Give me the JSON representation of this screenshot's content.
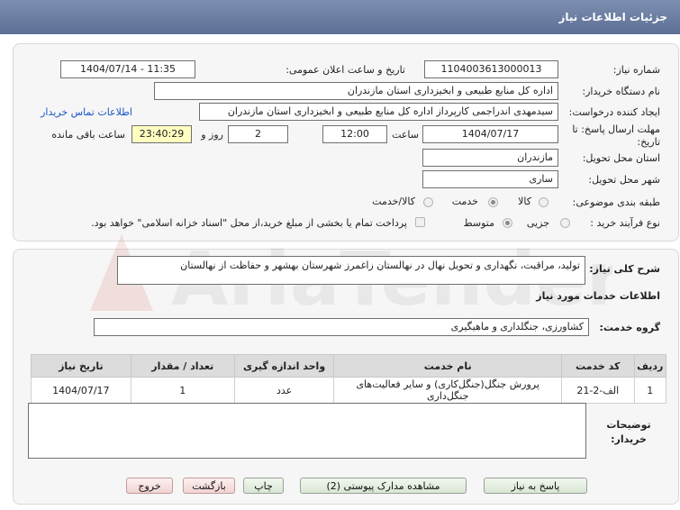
{
  "header": {
    "title": "جزئیات اطلاعات نیاز"
  },
  "form": {
    "need_number_label": "شماره نیاز:",
    "need_number": "1104003613000013",
    "announce_label": "تاریخ و ساعت اعلان عمومی:",
    "announce_value": "1404/07/14 - 11:35",
    "buyer_org_label": "نام دستگاه خریدار:",
    "buyer_org": "اداره کل منابع طبیعی و ابخیزداری استان مازندران",
    "requester_label": "ایجاد کننده درخواست:",
    "requester": "سیدمهدی اندراجمی کارپرداز اداره کل منابع طبیعی و ابخیزداری استان مازندران",
    "contact_link": "اطلاعات تماس خریدار",
    "deadline_label": "مهلت ارسال پاسخ: تا تاریخ:",
    "deadline_date": "1404/07/17",
    "time_label": "ساعت",
    "deadline_time": "12:00",
    "days_value": "2",
    "days_label": "روز و",
    "remaining_time": "23:40:29",
    "remaining_label": "ساعت باقی مانده",
    "province_label": "استان محل تحویل:",
    "province": "مازندران",
    "city_label": "شهر محل تحویل:",
    "city": "ساری",
    "category_label": "طبقه بندی موضوعی:",
    "category_options": [
      "کالا",
      "خدمت",
      "کالا/خدمت"
    ],
    "purchase_type_label": "نوع فرآیند خرید :",
    "purchase_options": [
      "جزیی",
      "متوسط"
    ],
    "treasury_note": "پرداخت تمام یا بخشی از مبلغ خرید،از محل \"اسناد خزانه اسلامی\" خواهد بود."
  },
  "description": {
    "label": "شرح کلی نیاز:",
    "text": "تولید، مراقبت، نگهداری و تحویل نهال در نهالستان زاغمرز شهرستان بهشهر و حفاظت از نهالستان"
  },
  "services": {
    "section_title": "اطلاعات خدمات مورد نیاز",
    "group_label": "گروه خدمت:",
    "group_value": "کشاورزی، جنگلداری و ماهیگیری",
    "columns": [
      "ردیف",
      "کد خدمت",
      "نام خدمت",
      "واحد اندازه گیری",
      "تعداد / مقدار",
      "تاریخ نیاز"
    ],
    "rows": [
      [
        "1",
        "الف-2-21",
        "پرورش جنگل(جنگل‌کاری) و سایر فعالیت‌های جنگل‌داری",
        "عدد",
        "1",
        "1404/07/17"
      ]
    ]
  },
  "buyer_notes": {
    "label": "توضیحات خریدار:",
    "value": ""
  },
  "buttons": {
    "reply": "پاسخ به نیاز",
    "attachments": "مشاهده مدارک پیوستی (2)",
    "print": "چاپ",
    "back": "بازگشت",
    "exit": "خروج"
  },
  "watermark": "AriaTender.net"
}
